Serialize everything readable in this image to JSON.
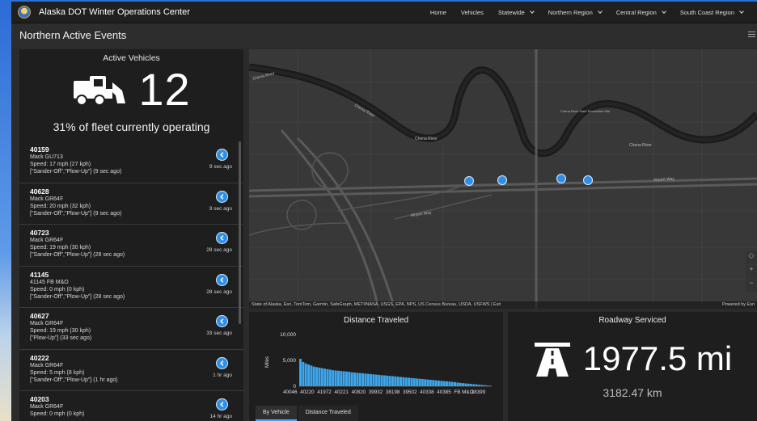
{
  "app": {
    "title": "Alaska DOT Winter Operations Center",
    "nav": [
      {
        "label": "Home",
        "has_menu": false
      },
      {
        "label": "Vehicles",
        "has_menu": false
      },
      {
        "label": "Statewide",
        "has_menu": true
      },
      {
        "label": "Northern Region",
        "has_menu": true
      },
      {
        "label": "Central Region",
        "has_menu": true
      },
      {
        "label": "South Coast Region",
        "has_menu": true
      }
    ]
  },
  "page": {
    "title": "Northern Active Events"
  },
  "active_vehicles": {
    "heading": "Active Vehicles",
    "count": "12",
    "fleet_text": "31% of fleet currently operating",
    "icon": "snowplow-icon"
  },
  "vehicles": [
    {
      "id": "40159",
      "model": "Mack GU713",
      "speed": "Speed: 17 mph (27 kph)",
      "status": "[\"Sander-Off\",\"Plow-Up\"] (9 sec ago)",
      "ago": "9 sec ago"
    },
    {
      "id": "40628",
      "model": "Mack GR64F",
      "speed": "Speed: 20 mph (32 kph)",
      "status": "[\"Sander-Off\",\"Plow-Up\"] (9 sec ago)",
      "ago": "9 sec ago"
    },
    {
      "id": "40723",
      "model": "Mack GR64F",
      "speed": "Speed: 19 mph (30 kph)",
      "status": "[\"Sander-Off\",\"Plow-Up\"] (28 sec ago)",
      "ago": "28 sec ago"
    },
    {
      "id": "41145",
      "model": "41145 FB M&O",
      "speed": "Speed: 0 mph (0 kph)",
      "status": "[\"Sander-Off\",\"Plow-Up\"] (28 sec ago)",
      "ago": "28 sec ago"
    },
    {
      "id": "40627",
      "model": "Mack GR64F",
      "speed": "Speed: 19 mph (30 kph)",
      "status": "[\"Plow-Up\"] (33 sec ago)",
      "ago": "33 sec ago"
    },
    {
      "id": "40222",
      "model": "Mack GR64F",
      "speed": "Speed: 5 mph (8 kph)",
      "status": "[\"Sander-Off\",\"Plow-Up\"] (1 hr ago)",
      "ago": "1 hr ago"
    },
    {
      "id": "40203",
      "model": "Mack GR64F",
      "speed": "Speed: 0 mph (0 kph)",
      "status": "",
      "ago": "14 hr ago"
    }
  ],
  "map": {
    "labels": [
      "Chena River",
      "Chena River",
      "Chena River",
      "Chena River",
      "Airport Way",
      "Airport Way",
      "Chena River State Recreation Site"
    ],
    "attribution": "State of Alaska, Esri, TomTom, Garmin, SafeGraph, METI/NASA, USGS, EPA, NPS, US Census Bureau, USDA, USFWS | Esri",
    "powered_by": "Powered by Esri",
    "zoom_in": "+",
    "zoom_out": "−"
  },
  "distance_panel": {
    "title": "Distance Traveled",
    "tabs": [
      "By Vehicle",
      "Distance Traveled"
    ],
    "active_tab": 0
  },
  "chart_data": {
    "type": "bar",
    "ylabel": "Miles",
    "ylim": [
      0,
      10000
    ],
    "yticks": [
      "10,000",
      "5,000",
      "0"
    ],
    "tick_labels": [
      "40046",
      "40220",
      "41972",
      "40221",
      "40820",
      "39932",
      "38198",
      "39502",
      "40338",
      "40385",
      "FB M&O",
      "38399"
    ],
    "values": [
      5300,
      4700,
      4400,
      4200,
      4000,
      3800,
      3700,
      3600,
      3500,
      3400,
      3300,
      3200,
      3100,
      3050,
      3000,
      2950,
      2900,
      2850,
      2800,
      2700,
      2650,
      2600,
      2550,
      2500,
      2450,
      2400,
      2350,
      2300,
      2250,
      2200,
      2150,
      2100,
      2050,
      2000,
      1950,
      1900,
      1850,
      1800,
      1750,
      1700,
      1650,
      1600,
      1550,
      1500,
      1450,
      1400,
      1350,
      1300,
      1250,
      1200,
      1150,
      1100,
      1050,
      1000,
      950,
      900,
      850,
      800,
      700,
      650,
      600,
      550,
      500,
      450,
      400,
      350,
      300,
      250,
      200,
      150,
      100
    ],
    "bar_color": "#3aa7ef",
    "grid": false
  },
  "road_panel": {
    "title": "Roadway Serviced",
    "miles": "1977.5 mi",
    "km": "3182.47 km",
    "icon": "highway-icon"
  }
}
